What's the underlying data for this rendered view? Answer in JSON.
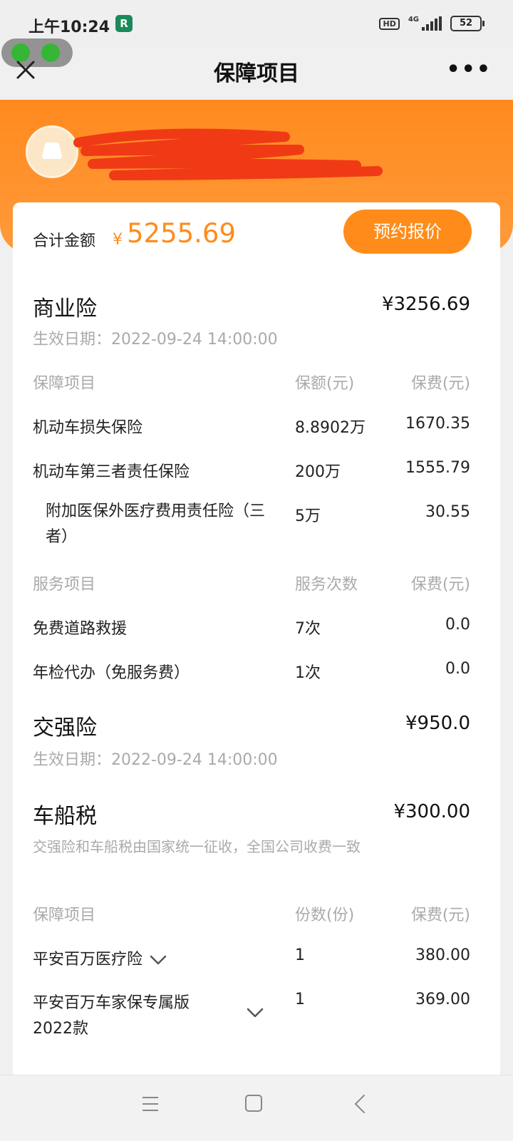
{
  "status": {
    "time": "上午10:24",
    "app_badge": "R",
    "hd": "HD",
    "network": "4G",
    "battery": "52"
  },
  "nav": {
    "title": "保障项目",
    "close_icon": "close-icon",
    "more": "•••"
  },
  "summary": {
    "total_label": "合计金额",
    "currency": "¥",
    "total_value": "5255.69",
    "quote_button": "预约报价"
  },
  "commercial": {
    "title": "商业险",
    "amount": "¥3256.69",
    "date": "生效日期：2022-09-24 14:00:00",
    "headers": [
      "保障项目",
      "保额(元)",
      "保费(元)"
    ],
    "items": [
      {
        "name": "机动车损失保险",
        "coverage": "8.8902万",
        "premium": "1670.35"
      },
      {
        "name": "机动车第三者责任保险",
        "coverage": "200万",
        "premium": "1555.79"
      },
      {
        "name": "附加医保外医疗费用责任险（三者）",
        "coverage": "5万",
        "premium": "30.55"
      }
    ],
    "service_headers": [
      "服务项目",
      "服务次数",
      "保费(元)"
    ],
    "services": [
      {
        "name": "免费道路救援",
        "count": "7次",
        "premium": "0.0"
      },
      {
        "name": "年检代办（免服务费）",
        "count": "1次",
        "premium": "0.0"
      }
    ]
  },
  "compulsory": {
    "title": "交强险",
    "amount": "¥950.0",
    "date": "生效日期：2022-09-24 14:00:00"
  },
  "tax": {
    "title": "车船税",
    "amount": "¥300.00",
    "note": "交强险和车船税由国家统一征收，全国公司收费一致"
  },
  "extras": {
    "headers": [
      "保障项目",
      "份数(份)",
      "保费(元)"
    ],
    "items": [
      {
        "name": "平安百万医疗险",
        "qty": "1",
        "premium": "380.00"
      },
      {
        "name": "平安百万车家保专属版2022款",
        "qty": "1",
        "premium": "369.00"
      }
    ]
  },
  "colors": {
    "accent": "#ff8c1a",
    "muted": "#aaaaaa"
  }
}
